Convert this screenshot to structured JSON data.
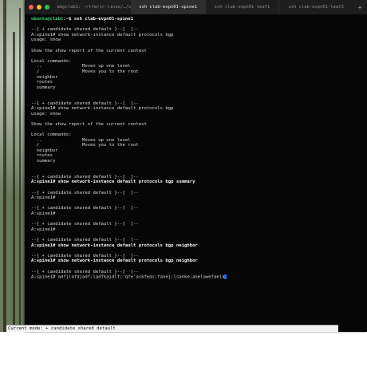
{
  "window": {
    "tabs": [
      {
        "label": "clab@clab1: ~/tfw/sr-linux/…/srl",
        "active": false
      },
      {
        "label": "ssh clab-evpn01-spine1",
        "active": true
      },
      {
        "label": "ssh clab-evpn01-leaf1",
        "active": false
      },
      {
        "label": "ssh clab-evpn01-leaf2",
        "active": false
      }
    ],
    "new_tab": "+"
  },
  "terminal": {
    "lines": [
      {
        "parts": [
          {
            "t": "ubuntu@clab1",
            "c": "user"
          },
          {
            "t": ":~$ ssh clab-evpn01-spine1"
          }
        ],
        "bold": true
      },
      {
        "t": ""
      },
      {
        "t": "--{ + candidate shared default }--[  ]--"
      },
      {
        "t": "A:spine1# show network-instance default protocols bgp"
      },
      {
        "t": "usage: show"
      },
      {
        "t": ""
      },
      {
        "t": "Show the show report of the current context"
      },
      {
        "t": ""
      },
      {
        "t": "Local commands:"
      },
      {
        "t": "  ..               Moves up one level"
      },
      {
        "t": "  /                Moves you to the root"
      },
      {
        "t": "  neighbor"
      },
      {
        "t": "  routes"
      },
      {
        "t": "  summary"
      },
      {
        "t": ""
      },
      {
        "t": ""
      },
      {
        "t": "--{ + candidate shared default }--[  ]--"
      },
      {
        "t": "A:spine1# show network-instance default protocols bgp"
      },
      {
        "t": "usage: show"
      },
      {
        "t": ""
      },
      {
        "t": "Show the show report of the current context"
      },
      {
        "t": ""
      },
      {
        "t": "Local commands:"
      },
      {
        "t": "  ..               Moves up one level"
      },
      {
        "t": "  /                Moves you to the root"
      },
      {
        "t": "  neighbor"
      },
      {
        "t": "  routes"
      },
      {
        "t": "  summary"
      },
      {
        "t": ""
      },
      {
        "t": ""
      },
      {
        "t": "--{ + candidate shared default }--[  ]--"
      },
      {
        "t": "A:spine1# show network-instance default protocols bgp summary",
        "bold": true
      },
      {
        "t": ""
      },
      {
        "t": "--{ + candidate shared default }--[  ]--"
      },
      {
        "t": "A:spine1#"
      },
      {
        "t": ""
      },
      {
        "t": "--{ + candidate shared default }--[  ]--"
      },
      {
        "t": "A:spine1#"
      },
      {
        "t": ""
      },
      {
        "t": "--{ + candidate shared default }--[  ]--"
      },
      {
        "t": "A:spine1#"
      },
      {
        "t": ""
      },
      {
        "t": "--{ + candidate shared default }--[  ]--"
      },
      {
        "t": "A:spine1# show network-instance default protocols bgp neighbor",
        "bold": true
      },
      {
        "t": ""
      },
      {
        "t": "--{ + candidate shared default }--[  ]--"
      },
      {
        "t": "A:spine1# show network-instance default protocols bgp neighbor",
        "bold": true
      },
      {
        "t": ""
      },
      {
        "t": "--{ + candidate shared default }--[  ]--"
      },
      {
        "t": "A:spine1# adfjlafdjadf;ladfkajdlf;'qfe'askfeas;fanej;lsanke;anelawefaela",
        "cursor": true
      }
    ]
  },
  "statusbar": {
    "text": "Current mode: + candidate shared default"
  },
  "colors": {
    "user_prompt": "#2fd17a",
    "cursor": "#1b6bff",
    "terminal_bg": "#060606"
  }
}
